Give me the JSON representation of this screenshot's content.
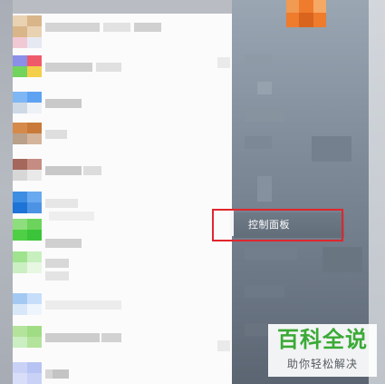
{
  "start_menu": {
    "right_pane": {
      "control_panel_label": "控制面板"
    },
    "programs": {
      "rows": [
        {
          "icon_colors": [
            "#e9d2b2",
            "#d9b58a"
          ],
          "text_color": "#d4d4d4"
        },
        {
          "icon_colors": [
            "#f1c9d4",
            "#e6e9f2"
          ],
          "text_color": "#e2e2e2"
        },
        {
          "icon_colors": [
            "#8a8fe8",
            "#ef5a6b"
          ],
          "text_color": "#cfcfcf"
        },
        {
          "icon_colors": [
            "#72d45d",
            "#f4cf4a"
          ],
          "text_color": "#e0e0e0"
        },
        {
          "icon_colors": [
            "#7fb6f4",
            "#5ea3f1"
          ],
          "text_color": "#c9c9c9"
        },
        {
          "icon_colors": [
            "#cfd9e6",
            "#eef1f5"
          ],
          "text_color": "#e8e8e8"
        },
        {
          "icon_colors": [
            "#d58a4c",
            "#c97a3a"
          ],
          "text_color": "#dedede"
        },
        {
          "icon_colors": [
            "#b8a08a",
            "#d4b49a"
          ],
          "text_color": "#e4e4e4"
        },
        {
          "icon_colors": [
            "#a5675b",
            "#c58c83"
          ],
          "text_color": "#c8c8c8"
        },
        {
          "icon_colors": [
            "#d7d7d7",
            "#e9e9e9"
          ],
          "text_color": "#dcdcdc"
        },
        {
          "icon_colors": [
            "#3d8de2",
            "#69a9ef"
          ],
          "text_color": "#e6e6e6"
        },
        {
          "icon_colors": [
            "#1e73d6",
            "#4d93e4"
          ],
          "text_color": "#eeeeee"
        },
        {
          "icon_colors": [
            "#8fde7d",
            "#6cd45c"
          ],
          "text_color": "#d0d0d0"
        },
        {
          "icon_colors": [
            "#4fcf45",
            "#3bc43a"
          ],
          "text_color": "#d8d8d8"
        },
        {
          "icon_colors": [
            "#9fe38f",
            "#c8efbe"
          ],
          "text_color": "#e3e3e3"
        },
        {
          "icon_colors": [
            "#cbefc2",
            "#e7f7e2"
          ],
          "text_color": "#ececec"
        },
        {
          "icon_colors": [
            "#a3c9f2",
            "#c6defa"
          ],
          "text_color": "#d2d2d2"
        },
        {
          "icon_colors": [
            "#d8e8f8",
            "#eef5fc"
          ],
          "text_color": "#e9e9e9"
        },
        {
          "icon_colors": [
            "#b4e39c",
            "#9fdc84"
          ],
          "text_color": "#cdcdcd"
        },
        {
          "icon_colors": [
            "#c9d2f6",
            "#b7c3f2"
          ],
          "text_color": "#d6d6d6"
        }
      ]
    }
  },
  "watermark": {
    "title": "百科全说",
    "subtitle": "助你轻松解决"
  },
  "colors": {
    "highlight_border": "#e0262c",
    "watermark_green": "#3aaa35",
    "user_avatar": "#ef7b2c"
  }
}
